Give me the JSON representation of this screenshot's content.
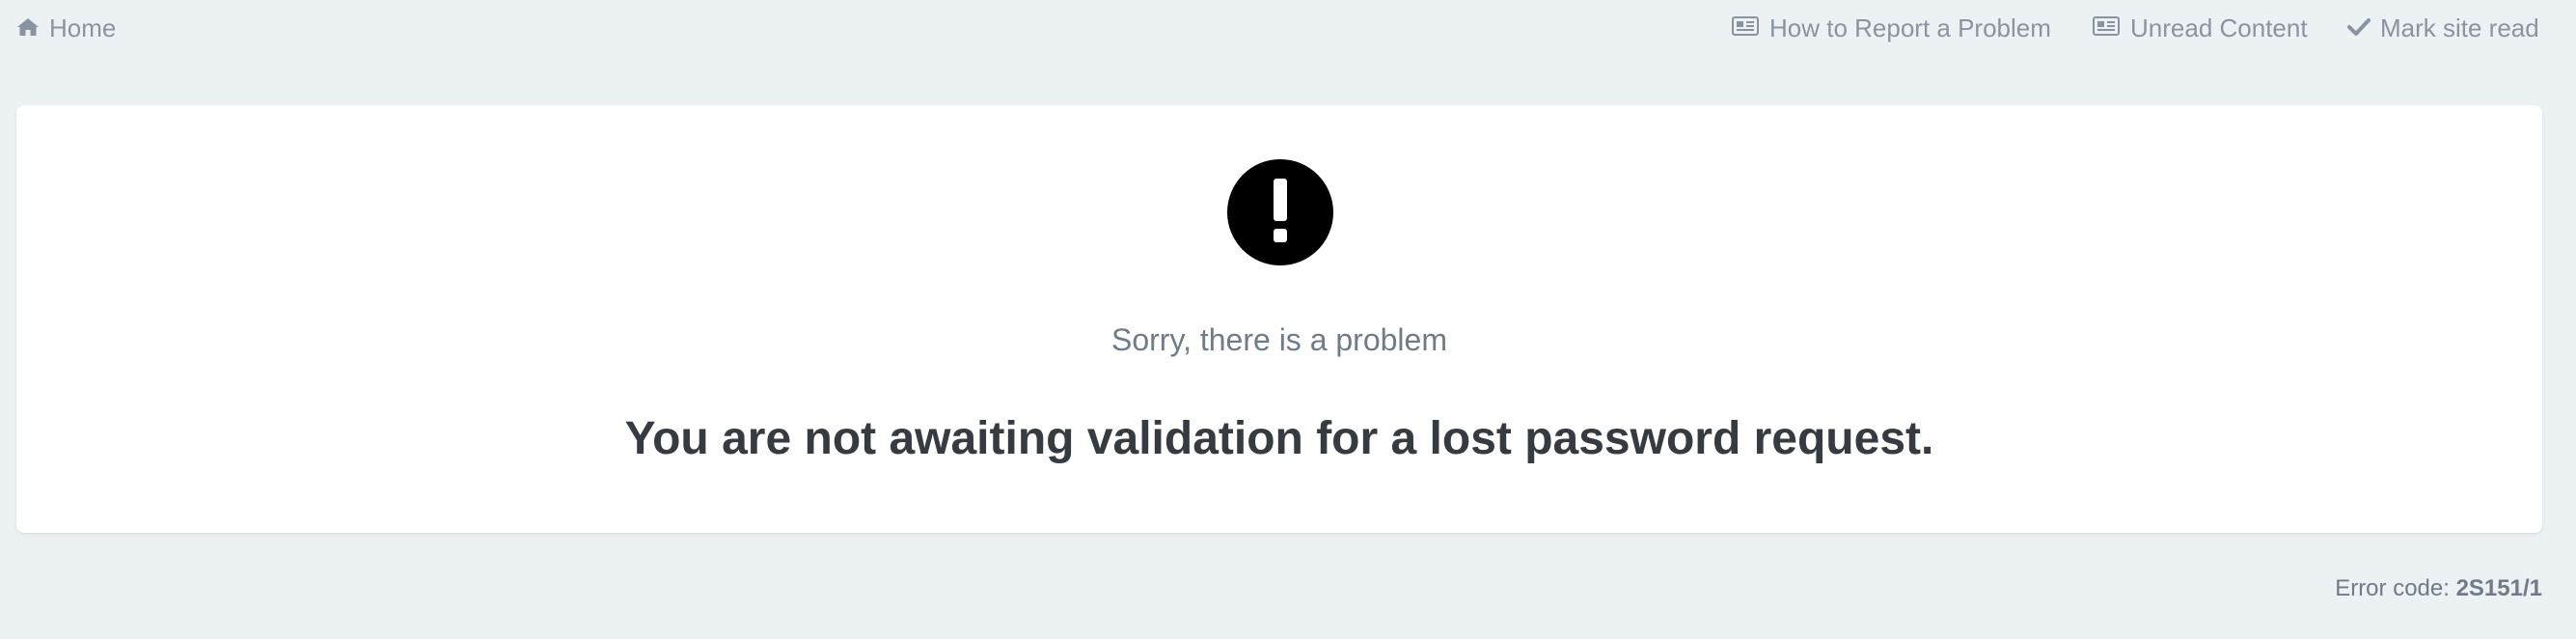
{
  "nav": {
    "home": {
      "label": "Home",
      "icon": "home-icon"
    },
    "report": {
      "label": "How to Report a Problem",
      "icon": "newspaper-icon"
    },
    "unread": {
      "label": "Unread Content",
      "icon": "newspaper-icon"
    },
    "mark_read": {
      "label": "Mark site read",
      "icon": "check-icon"
    }
  },
  "error": {
    "icon": "exclamation-circle-icon",
    "heading": "Sorry, there is a problem",
    "message": "You are not awaiting validation for a lost password request.",
    "code_label": "Error code:",
    "code_value": "2S151/1"
  },
  "colors": {
    "page_background": "#ecf1f4",
    "card_background": "#ffffff",
    "nav_text": "#8a94a0",
    "heading_text": "#6f7b89",
    "message_text": "#353b41",
    "icon": "#000000"
  }
}
